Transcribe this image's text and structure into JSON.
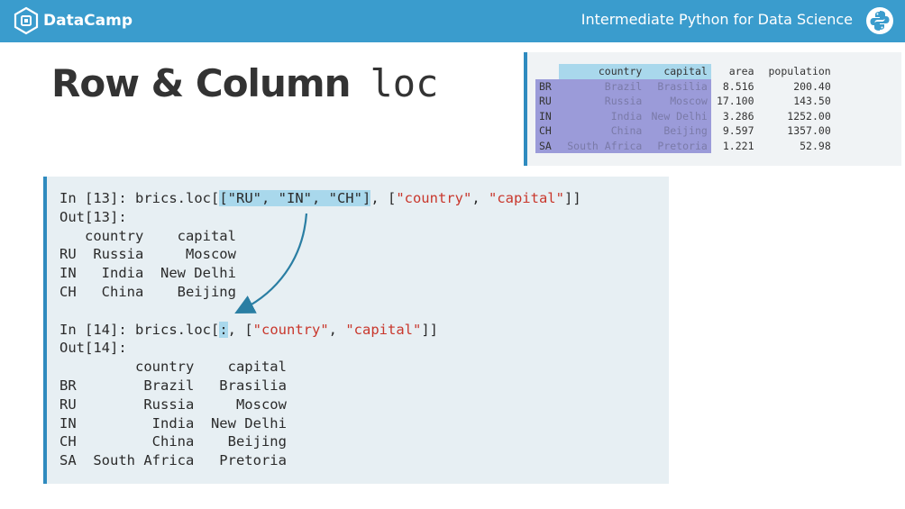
{
  "header": {
    "brand": "DataCamp",
    "course": "Intermediate Python for Data Science"
  },
  "slide": {
    "title": "Row & Column",
    "title_code": "loc"
  },
  "dataframe": {
    "columns": [
      "country",
      "capital",
      "area",
      "population"
    ],
    "rows": [
      {
        "idx": "BR",
        "country": "Brazil",
        "capital": "Brasilia",
        "area": "8.516",
        "population": "200.40"
      },
      {
        "idx": "RU",
        "country": "Russia",
        "capital": "Moscow",
        "area": "17.100",
        "population": "143.50"
      },
      {
        "idx": "IN",
        "country": "India",
        "capital": "New Delhi",
        "area": "3.286",
        "population": "1252.00"
      },
      {
        "idx": "CH",
        "country": "China",
        "capital": "Beijing",
        "area": "9.597",
        "population": "1357.00"
      },
      {
        "idx": "SA",
        "country": "South Africa",
        "capital": "Pretoria",
        "area": "1.221",
        "population": "52.98"
      }
    ]
  },
  "code": {
    "in13_prompt": "In [13]: ",
    "in13_call": "brics.loc[",
    "in13_rows": "[\"RU\", \"IN\", \"CH\"]",
    "in13_sep": ", [",
    "in13_str1": "\"country\"",
    "in13_comma": ", ",
    "in13_str2": "\"capital\"",
    "in13_end": "]]",
    "out13": "Out[13]:\n   country    capital\nRU  Russia     Moscow\nIN   India  New Delhi\nCH   China    Beijing",
    "in14_prompt": "In [14]: ",
    "in14_call": "brics.loc[",
    "in14_colon": ":",
    "in14_sep": ", [",
    "in14_str1": "\"country\"",
    "in14_comma": ", ",
    "in14_str2": "\"capital\"",
    "in14_end": "]]",
    "out14": "Out[14]:\n         country    capital\nBR        Brazil   Brasilia\nRU        Russia     Moscow\nIN         India  New Delhi\nCH         China    Beijing\nSA  South Africa   Pretoria"
  },
  "colors": {
    "header_bg": "#3a9ccd",
    "accent": "#2f8bbf",
    "string": "#c9372c",
    "highlight_col": "#a9d8ec",
    "highlight_sel": "#9b9bd9"
  }
}
